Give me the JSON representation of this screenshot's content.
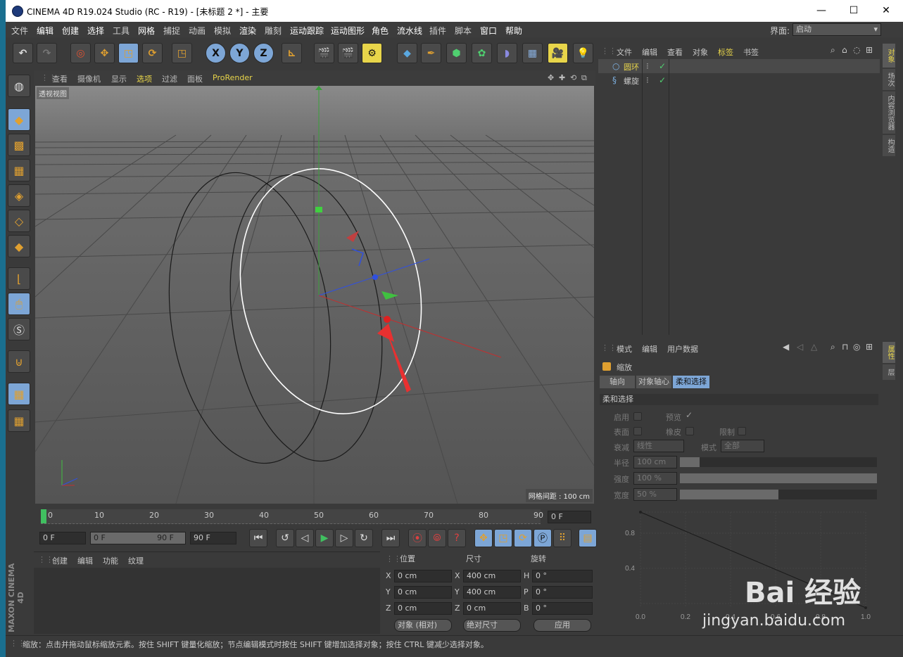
{
  "window": {
    "title": "CINEMA 4D R19.024 Studio (RC - R19) - [未标题 2 *] - 主要",
    "minimize": "—",
    "maximize": "☐",
    "close": "✕"
  },
  "menu": [
    "文件",
    "编辑",
    "创建",
    "选择",
    "工具",
    "网格",
    "捕捉",
    "动画",
    "模拟",
    "渲染",
    "雕刻",
    "运动跟踪",
    "运动图形",
    "角色",
    "流水线",
    "插件",
    "脚本",
    "窗口",
    "帮助"
  ],
  "layout": {
    "label": "界面:",
    "value": "启动"
  },
  "toolbar": {
    "axis_x": "X",
    "axis_y": "Y",
    "axis_z": "Z"
  },
  "viewport": {
    "menu": [
      "查看",
      "摄像机",
      "显示",
      "选项",
      "过滤",
      "面板",
      "ProRender"
    ],
    "label": "透视视图",
    "grid_spacing": "网格间距 : 100 cm"
  },
  "timeline": {
    "ticks": [
      "0",
      "10",
      "20",
      "30",
      "40",
      "50",
      "60",
      "70",
      "80",
      "90"
    ],
    "current_frame": "0 F"
  },
  "transport": {
    "start": "0 F",
    "range_start": "0 F",
    "range_end": "90 F",
    "end": "90 F"
  },
  "material": {
    "menu": [
      "创建",
      "编辑",
      "功能",
      "纹理"
    ]
  },
  "coords": {
    "headers": [
      "位置",
      "尺寸",
      "旋转"
    ],
    "rows": [
      {
        "axis": "X",
        "pos": "0 cm",
        "size_axis": "X",
        "size": "400 cm",
        "rot_axis": "H",
        "rot": "0 °"
      },
      {
        "axis": "Y",
        "pos": "0 cm",
        "size_axis": "Y",
        "size": "400 cm",
        "rot_axis": "P",
        "rot": "0 °"
      },
      {
        "axis": "Z",
        "pos": "0 cm",
        "size_axis": "Z",
        "size": "0 cm",
        "rot_axis": "B",
        "rot": "0 °"
      }
    ],
    "mode": "对象 (相对)",
    "size_mode": "绝对尺寸",
    "apply": "应用"
  },
  "objects": {
    "menu": [
      "文件",
      "编辑",
      "查看",
      "对象",
      "标签",
      "书签"
    ],
    "items": [
      {
        "name": "圆环",
        "selected": true
      },
      {
        "name": "螺旋",
        "selected": false
      }
    ],
    "side_tabs": [
      "对象",
      "场次",
      "内容浏览器",
      "构造"
    ]
  },
  "attributes": {
    "menu": [
      "模式",
      "编辑",
      "用户数据"
    ],
    "tool": "缩放",
    "tabs": [
      "轴向",
      "对象轴心",
      "柔和选择"
    ],
    "section": "柔和选择",
    "enable": "启用",
    "preview": "预览",
    "surface": "表面",
    "rubber": "橡皮",
    "restrict": "限制",
    "falloff_label": "衰减",
    "falloff_value": "线性",
    "mode_label": "模式",
    "mode_value": "全部",
    "radius_label": "半径",
    "radius_value": "100 cm",
    "strength_label": "强度",
    "strength_value": "100 %",
    "width_label": "宽度",
    "width_value": "50 %",
    "radius_fraction": 0.1,
    "strength_fraction": 1.0,
    "width_fraction": 0.5,
    "curve_y_ticks": [
      "0.8",
      "0.4"
    ],
    "curve_x_ticks": [
      "0.0",
      "0.2",
      "0.4",
      "0.6",
      "0.8",
      "1.0"
    ],
    "side_tabs": [
      "属性",
      "层"
    ]
  },
  "status": "缩放：点击并拖动鼠标缩放元素。按住 SHIFT 键量化缩放；节点编辑模式时按住 SHIFT 键增加选择对象；按住 CTRL 键减少选择对象。",
  "brand": "MAXON CINEMA 4D",
  "watermark": {
    "text": "Bai 经验",
    "url": "jingyan.baidu.com"
  }
}
